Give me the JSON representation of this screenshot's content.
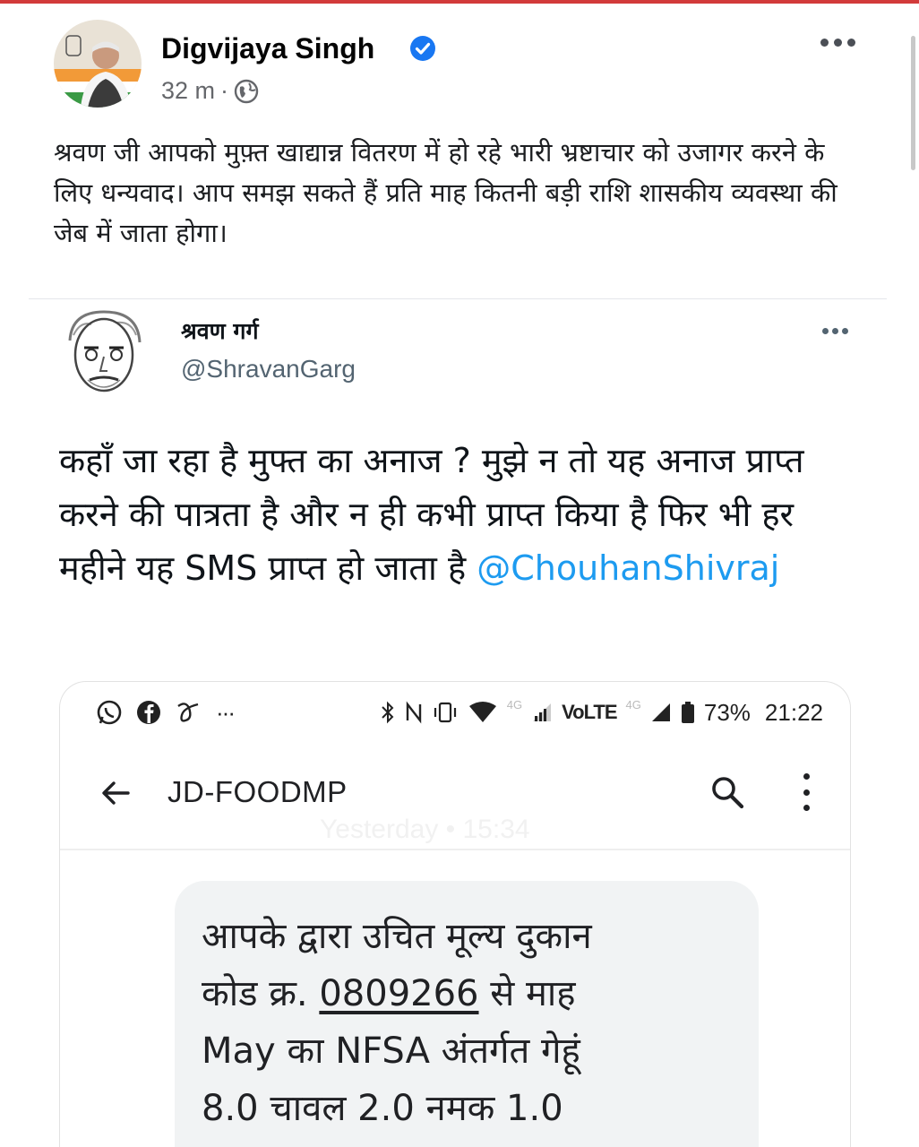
{
  "post": {
    "author": "Digvijaya Singh",
    "time": "32 m",
    "separator": "·",
    "caption": "श्रवण जी आपको मुफ़्त खाद्यान्न वितरण में हो रहे भारी भ्रष्टाचार को उजागर करने के लिए धन्यवाद। आप समझ सकते हैं प्रति माह कितनी बड़ी राशि शासकीय व्यवस्था की जेब में जाता होगा।"
  },
  "tweet": {
    "name": "श्रवण गर्ग",
    "handle": "@ShravanGarg",
    "text": "कहाँ जा रहा है मुफ्त का अनाज ? मुझे न तो यह अनाज प्राप्त करने की पात्रता है और न ही  कभी प्राप्त किया है फिर भी हर महीने यह SMS प्राप्त हो जाता है ",
    "mention": "@ChouhanShivraj"
  },
  "phone": {
    "status": {
      "left_icons": [
        "whatsapp-icon",
        "facebook-icon",
        "app-icon",
        "more-notifications-icon"
      ],
      "ellipsis": "···",
      "network_4g_1": "4G",
      "volte": "VoLTE",
      "network_4g_2": "4G",
      "battery": "73%",
      "clock": "21:22"
    },
    "sender": "JD-FOODMP",
    "date_watermark": "Yesterday • 15:34",
    "sms": {
      "line1": "आपके द्वारा उचित मूल्य दुकान",
      "line2_prefix": "कोड क्र. ",
      "shop_code": "0809266",
      "line2_suffix": " से माह",
      "line3": "May का NFSA अंतर्गत गेहूं",
      "line4": "8.0 चावल 2.0 नमक 1.0"
    }
  },
  "colors": {
    "accent_red": "#d23a3a",
    "verified_blue": "#1877f2",
    "mention_blue": "#1d9bf0",
    "sms_bubble": "#f1f3f4"
  }
}
